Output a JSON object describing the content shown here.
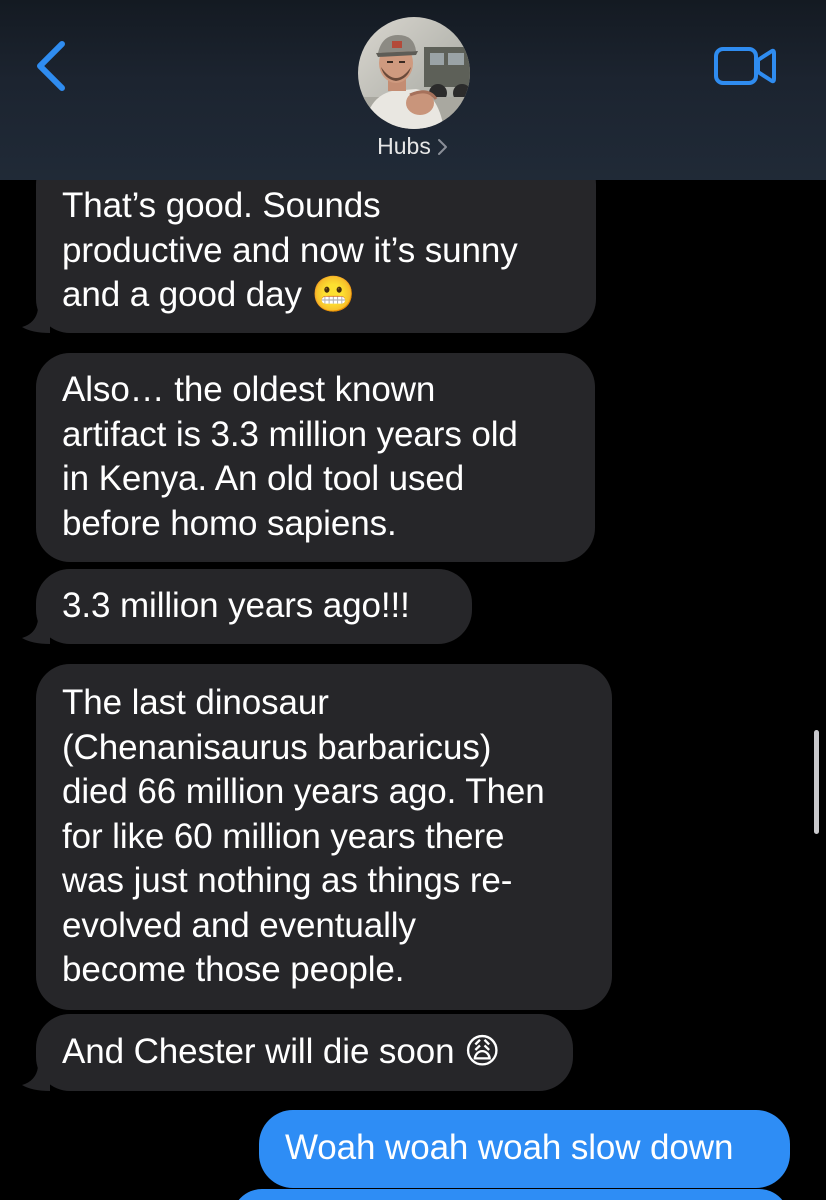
{
  "header": {
    "back_icon": "chevron-left-icon",
    "contact_name": "Hubs",
    "contact_chevron": ">",
    "video_icon": "video-camera-icon",
    "avatar": "contact-photo"
  },
  "messages": [
    {
      "direction": "incoming",
      "text": "That’s good. Sounds\nproductive and now it’s sunny\nand a good day 😬"
    },
    {
      "direction": "incoming",
      "text": "Also… the oldest known\nartifact is 3.3 million years old\nin Kenya. An old tool used\nbefore homo sapiens."
    },
    {
      "direction": "incoming",
      "text": "3.3 million years ago!!!"
    },
    {
      "direction": "incoming",
      "text": "The last dinosaur\n(Chenanisaurus barbaricus)\ndied 66 million years ago. Then\nfor like 60 million years there\nwas just nothing as things re-\nevolved and eventually\nbecome those people."
    },
    {
      "direction": "incoming",
      "text": "And Chester will die soon 😩"
    },
    {
      "direction": "outgoing",
      "text": "Woah woah woah slow down"
    }
  ],
  "colors": {
    "incoming_bubble": "#262629",
    "outgoing_bubble": "#2e8df5",
    "accent": "#2f8cf0",
    "background": "#000000"
  }
}
